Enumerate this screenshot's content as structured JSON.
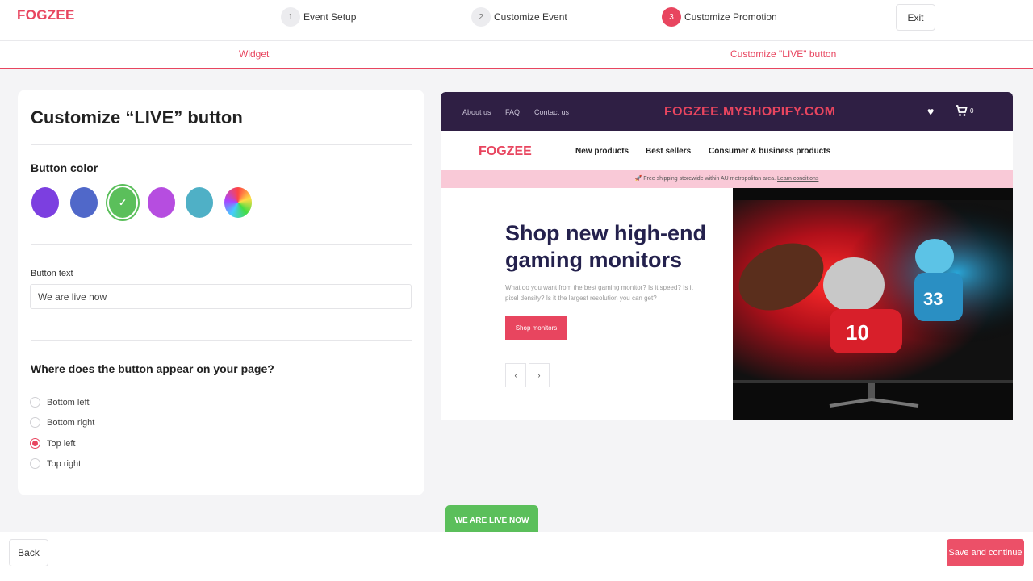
{
  "app": {
    "logo": "FOGZEE"
  },
  "steps": [
    {
      "num": "1",
      "label": "Event Setup"
    },
    {
      "num": "2",
      "label": "Customize Event"
    },
    {
      "num": "3",
      "label": "Customize Promotion"
    }
  ],
  "header": {
    "exit_label": "Exit"
  },
  "subtabs": {
    "widget": "Widget",
    "customize_live": "Customize \"LIVE\" button"
  },
  "panel": {
    "title": "Customize “LIVE” button",
    "button_color_title": "Button color",
    "colors": [
      "#7c3fe0",
      "#5068c9",
      "#5bbf5b",
      "#b64de0",
      "#4fb0c6",
      "rainbow"
    ],
    "selected_color_index": 2,
    "button_text_label": "Button text",
    "button_text_value": "We are live now",
    "position_title": "Where does the button appear on your page?",
    "positions": [
      "Bottom left",
      "Bottom right",
      "Top left",
      "Top right"
    ],
    "selected_position": "Top left"
  },
  "preview": {
    "top_links": [
      "About us",
      "FAQ",
      "Contact us"
    ],
    "domain": "FOGZEE.MYSHOPIFY.COM",
    "cart_count": "0",
    "shop_logo": "FOGZEE",
    "nav": [
      "New products",
      "Best sellers",
      "Consumer & business products"
    ],
    "promo_text": "Free shipping storewide within AU metropolitan area.",
    "promo_link": "Learn conditions",
    "hero_title": "Shop new high-end gaming monitors",
    "hero_desc": "What do you want from the best gaming monitor? Is it speed? Is it pixel density? Is it the largest resolution you can get?",
    "hero_cta": "Shop monitors",
    "prev_arrow": "‹",
    "next_arrow": "›",
    "live_button": "WE ARE LIVE NOW"
  },
  "footer": {
    "back_label": "Back",
    "save_label": "Save and continue"
  },
  "theme": {
    "accent": "#e8455f",
    "live_green": "#5bbf5b",
    "shop_dark": "#2f1f44"
  }
}
